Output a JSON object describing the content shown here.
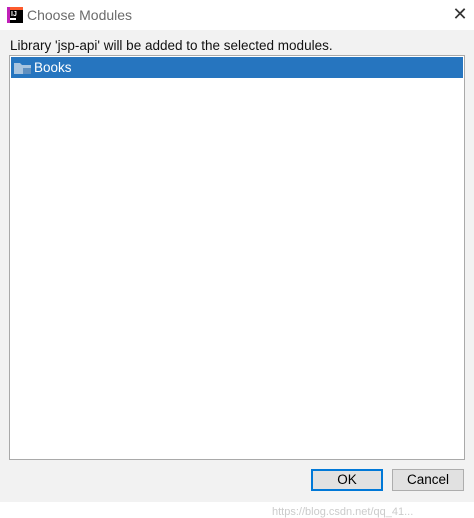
{
  "window": {
    "title": "Choose Modules",
    "close_label": "✕"
  },
  "dialog": {
    "message": "Library 'jsp-api' will be added to the selected modules."
  },
  "modules": [
    {
      "label": "Books",
      "selected": true,
      "icon": "module-folder-icon"
    }
  ],
  "buttons": {
    "ok": "OK",
    "cancel": "Cancel"
  },
  "watermark": "https://blog.csdn.net/qq_41..."
}
